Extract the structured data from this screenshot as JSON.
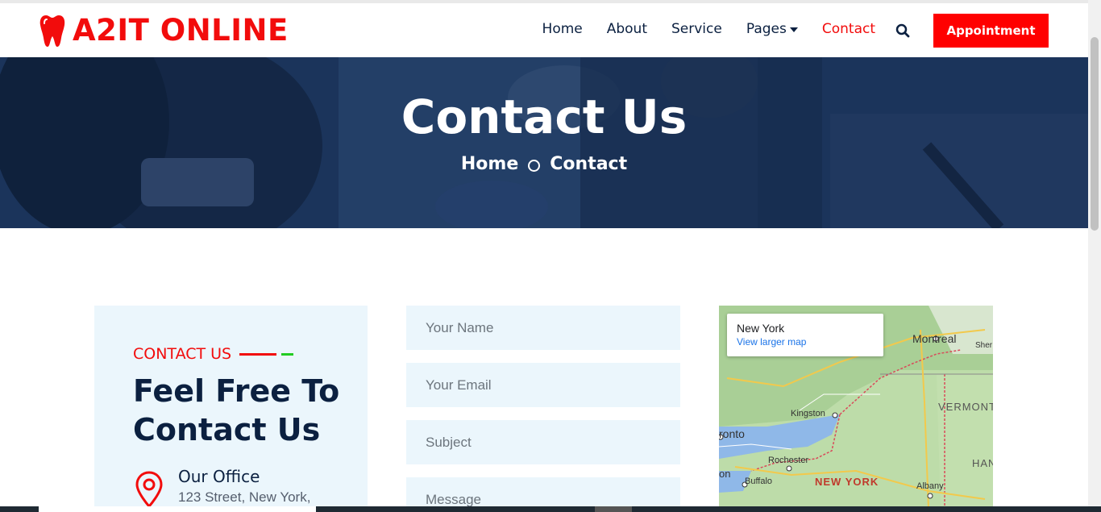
{
  "brand": {
    "name": "A2IT ONLINE",
    "icon": "tooth-icon",
    "color": "#f20c0c"
  },
  "nav": {
    "items": [
      {
        "label": "Home"
      },
      {
        "label": "About"
      },
      {
        "label": "Service"
      },
      {
        "label": "Pages"
      },
      {
        "label": "Contact"
      }
    ],
    "search_icon": "search-icon",
    "appointment_label": "Appointment"
  },
  "hero": {
    "title": "Contact Us",
    "breadcrumb": {
      "home": "Home",
      "current": "Contact"
    }
  },
  "contact_card": {
    "eyebrow": "CONTACT US",
    "title": "Feel Free To Contact Us",
    "office_title": "Our Office",
    "office_address": "123 Street, New York,",
    "office_icon": "location-pin-icon"
  },
  "form": {
    "name_placeholder": "Your Name",
    "email_placeholder": "Your Email",
    "subject_placeholder": "Subject",
    "message_placeholder": "Message"
  },
  "map": {
    "place": "New York",
    "link": "View larger map",
    "labels": {
      "montreal": "Montreal",
      "sher": "Sher",
      "vermont": "VERMONT",
      "kingston": "Kingston",
      "toronto": "ronto",
      "rochester": "Rochester",
      "ham": "HAN",
      "on": "on",
      "buffalo": "Buffalo",
      "new_york": "NEW YORK",
      "albany": "Albany"
    }
  },
  "colors": {
    "accent": "#f20c0c",
    "navy": "#0b2040",
    "light_bg": "#ebf6fc"
  }
}
